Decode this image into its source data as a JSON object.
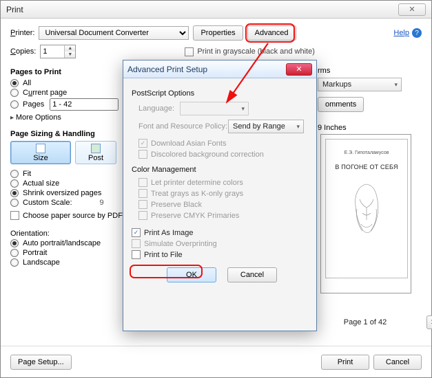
{
  "window": {
    "title": "Print"
  },
  "help": {
    "label": "Help"
  },
  "printer": {
    "label": "Printer:",
    "value": "Universal Document Converter",
    "properties_btn": "Properties",
    "advanced_btn": "Advanced"
  },
  "copies": {
    "label": "Copies:",
    "value": "1"
  },
  "grayscale": {
    "label": "Print in grayscale (black and white)"
  },
  "pages_to_print": {
    "title": "Pages to Print",
    "all": "All",
    "current": "Current page",
    "pages": "Pages",
    "range": "1 - 42",
    "more": "More Options"
  },
  "sizing": {
    "title": "Page Sizing & Handling",
    "size": "Size",
    "poster": "Post",
    "fit": "Fit",
    "actual": "Actual size",
    "shrink": "Shrink oversized pages",
    "custom": "Custom Scale:",
    "custom_val": "9",
    "choose_paper": "Choose paper source by PDF p"
  },
  "orientation": {
    "title": "Orientation:",
    "auto": "Auto portrait/landscape",
    "portrait": "Portrait",
    "landscape": "Landscape"
  },
  "right_partial": {
    "rms": "rms",
    "markups": "Markups",
    "comments_btn": "omments",
    "inches": "9 Inches"
  },
  "preview": {
    "author": "Е.Э. Гипоталамусов",
    "book_title": "В ПОГОНЕ ОТ СЕБЯ",
    "page_text": "Page 1 of 42"
  },
  "footer": {
    "page_setup": "Page Setup...",
    "print": "Print",
    "cancel": "Cancel"
  },
  "modal": {
    "title": "Advanced Print Setup",
    "postscript": "PostScript Options",
    "language": "Language:",
    "font_policy": "Font and Resource Policy:",
    "send_by_range": "Send by Range",
    "download_asian": "Download Asian Fonts",
    "discolored": "Discolored background correction",
    "color_mgmt": "Color Management",
    "let_printer": "Let printer determine colors",
    "treat_grays": "Treat grays as K-only grays",
    "preserve_black": "Preserve Black",
    "preserve_cmyk": "Preserve CMYK Primaries",
    "print_as_image": "Print As Image",
    "simulate": "Simulate Overprinting",
    "print_to_file": "Print to File",
    "ok": "OK",
    "cancel": "Cancel"
  }
}
